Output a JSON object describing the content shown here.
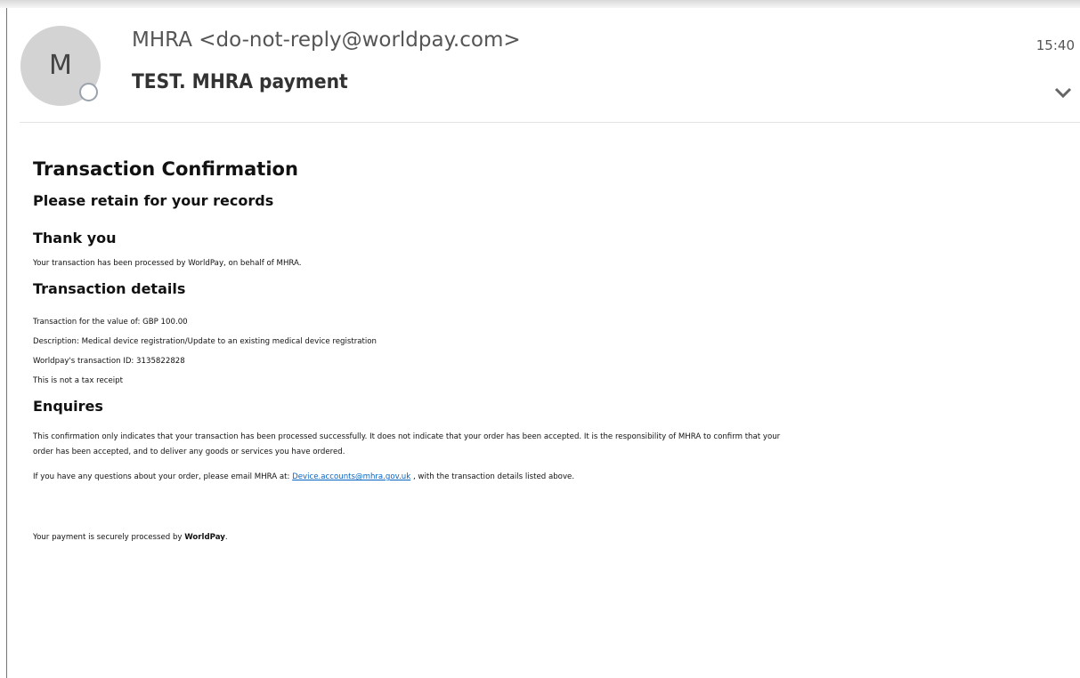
{
  "header": {
    "avatar_letter": "M",
    "sender": "MHRA <do-not-reply@worldpay.com>",
    "subject": "TEST. MHRA payment",
    "time": "15:40"
  },
  "email": {
    "title": "Transaction Confirmation",
    "retain": "Please retain for your records",
    "thanks_heading": "Thank you",
    "thanks_text": "Your transaction has been processed by WorldPay, on behalf of MHRA.",
    "details_heading": "Transaction details",
    "value_line": "Transaction for the value of: GBP 100.00",
    "description_line": "Description: Medical device registration/Update to an existing medical device registration",
    "transaction_id_line": "Worldpay's transaction ID: 3135822828",
    "tax_line": "This is not a tax receipt",
    "enquires_heading": "Enquires",
    "enquires_text_1": "This confirmation only indicates that your transaction has been processed successfully. It does not indicate that your order has been accepted. It is the responsibility of MHRA to confirm that your",
    "enquires_text_2": "order has been accepted, and to deliver any goods or services you have ordered.",
    "questions_prefix": "If you have any questions about your order, please email MHRA at: ",
    "questions_email": "Device.accounts@mhra.gov.uk",
    "questions_suffix": " , with the transaction details listed above.",
    "footer_prefix": "Your payment is securely processed by ",
    "footer_brand": "WorldPay",
    "footer_suffix": "."
  },
  "colors": {
    "accent": "#2b88d8",
    "link": "#0563c1",
    "avatar_bg": "#d3d3d3"
  }
}
